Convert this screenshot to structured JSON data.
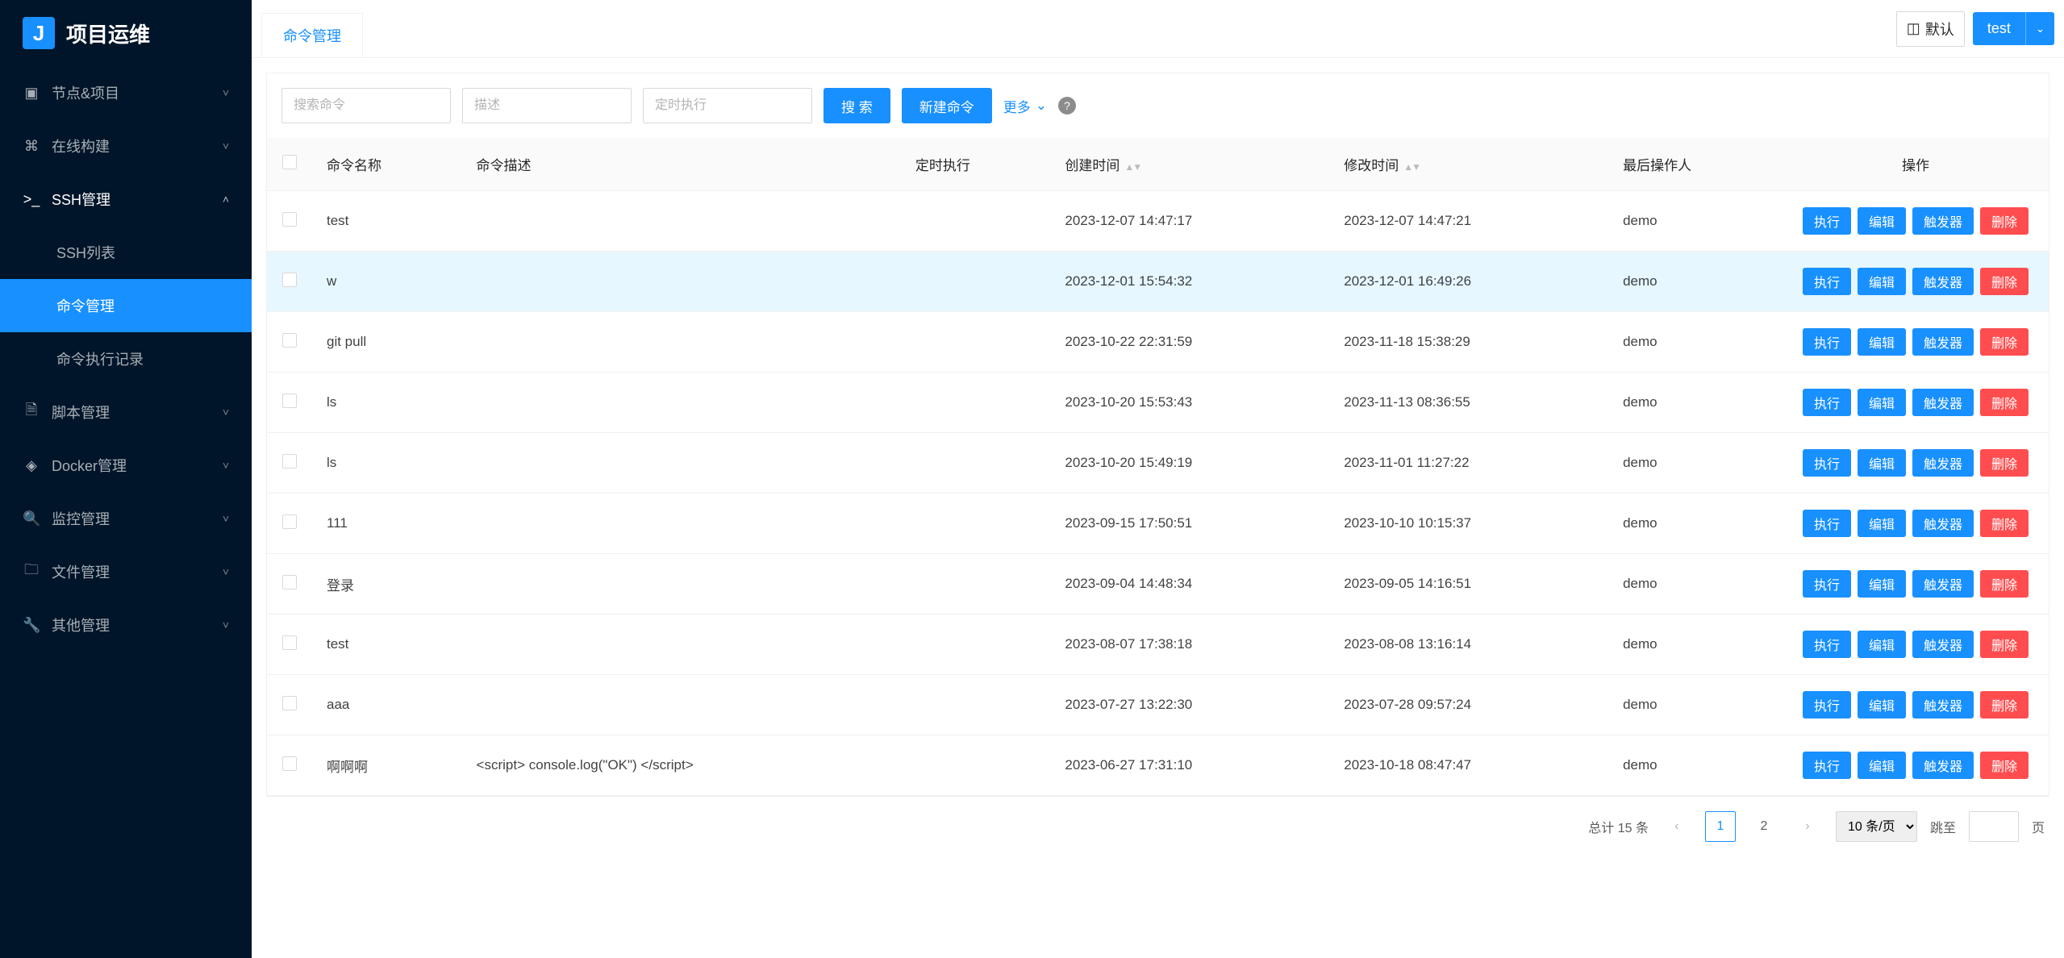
{
  "app": {
    "title": "项目运维"
  },
  "sidebar": {
    "items": [
      {
        "label": "节点&项目",
        "expanded": false
      },
      {
        "label": "在线构建",
        "expanded": false
      },
      {
        "label": "SSH管理",
        "expanded": true,
        "children": [
          {
            "label": "SSH列表",
            "active": false
          },
          {
            "label": "命令管理",
            "active": true
          },
          {
            "label": "命令执行记录",
            "active": false
          }
        ]
      },
      {
        "label": "脚本管理",
        "expanded": false
      },
      {
        "label": "Docker管理",
        "expanded": false
      },
      {
        "label": "监控管理",
        "expanded": false
      },
      {
        "label": "文件管理",
        "expanded": false
      },
      {
        "label": "其他管理",
        "expanded": false
      }
    ]
  },
  "topbar": {
    "tab_label": "命令管理",
    "workspace_chip": "默认",
    "workspace_dropdown": "test"
  },
  "toolbar": {
    "search_cmd_placeholder": "搜索命令",
    "desc_placeholder": "描述",
    "cron_placeholder": "定时执行",
    "search_btn": "搜 索",
    "new_btn": "新建命令",
    "more_link": "更多",
    "help_tooltip": "?"
  },
  "table": {
    "columns": {
      "name": "命令名称",
      "desc": "命令描述",
      "cron": "定时执行",
      "created": "创建时间",
      "modified": "修改时间",
      "operator": "最后操作人",
      "actions": "操作"
    },
    "action_labels": {
      "run": "执行",
      "edit": "编辑",
      "trigger": "触发器",
      "delete": "删除"
    },
    "rows": [
      {
        "name": "test",
        "desc": "",
        "cron": "",
        "created": "2023-12-07 14:47:17",
        "modified": "2023-12-07 14:47:21",
        "operator": "demo"
      },
      {
        "name": "w",
        "desc": "",
        "cron": "",
        "created": "2023-12-01 15:54:32",
        "modified": "2023-12-01 16:49:26",
        "operator": "demo",
        "highlight": true
      },
      {
        "name": "git pull",
        "desc": "",
        "cron": "",
        "created": "2023-10-22 22:31:59",
        "modified": "2023-11-18 15:38:29",
        "operator": "demo"
      },
      {
        "name": "ls",
        "desc": "",
        "cron": "",
        "created": "2023-10-20 15:53:43",
        "modified": "2023-11-13 08:36:55",
        "operator": "demo"
      },
      {
        "name": "ls",
        "desc": "",
        "cron": "",
        "created": "2023-10-20 15:49:19",
        "modified": "2023-11-01 11:27:22",
        "operator": "demo"
      },
      {
        "name": "111",
        "desc": "",
        "cron": "",
        "created": "2023-09-15 17:50:51",
        "modified": "2023-10-10 10:15:37",
        "operator": "demo"
      },
      {
        "name": "登录",
        "desc": "",
        "cron": "",
        "created": "2023-09-04 14:48:34",
        "modified": "2023-09-05 14:16:51",
        "operator": "demo"
      },
      {
        "name": "test",
        "desc": "",
        "cron": "",
        "created": "2023-08-07 17:38:18",
        "modified": "2023-08-08 13:16:14",
        "operator": "demo"
      },
      {
        "name": "aaa",
        "desc": "",
        "cron": "",
        "created": "2023-07-27 13:22:30",
        "modified": "2023-07-28 09:57:24",
        "operator": "demo"
      },
      {
        "name": "啊啊啊",
        "desc": "<script> console.log(\"OK\") </script>",
        "cron": "",
        "created": "2023-06-27 17:31:10",
        "modified": "2023-10-18 08:47:47",
        "operator": "demo"
      }
    ]
  },
  "pagination": {
    "total_text": "总计 15 条",
    "current": "1",
    "next": "2",
    "size_label": "10 条/页",
    "jump_label": "跳至",
    "page_suffix": "页"
  }
}
